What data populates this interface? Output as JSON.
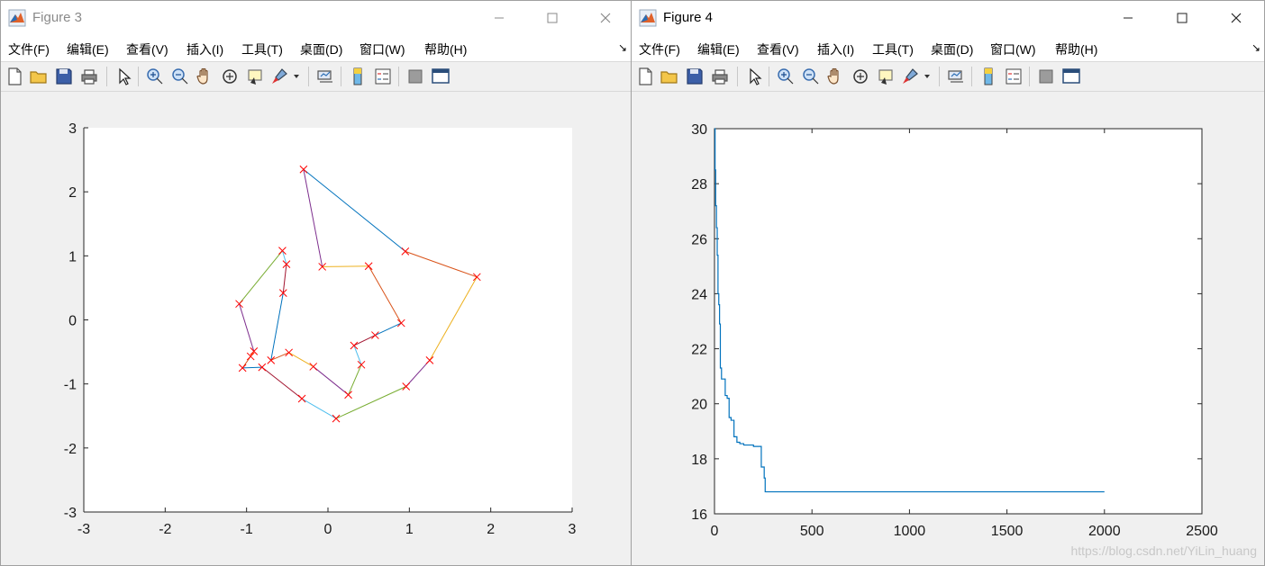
{
  "windows": [
    {
      "title": "Figure 3",
      "menus": [
        "文件(F)",
        "编辑(E)",
        "查看(V)",
        "插入(I)",
        "工具(T)",
        "桌面(D)",
        "窗口(W)",
        "帮助(H)"
      ]
    },
    {
      "title": "Figure 4",
      "menus": [
        "文件(F)",
        "编辑(E)",
        "查看(V)",
        "插入(I)",
        "工具(T)",
        "桌面(D)",
        "窗口(W)",
        "帮助(H)"
      ]
    }
  ],
  "toolbar_icons": [
    "new-figure-icon",
    "open-file-icon",
    "save-icon",
    "print-icon",
    "edit-plot-icon",
    "zoom-in-icon",
    "zoom-out-icon",
    "pan-icon",
    "rotate-3d-icon",
    "data-cursor-icon",
    "brush-icon",
    "brush-dropdown-icon",
    "link-plot-icon",
    "insert-colorbar-icon",
    "insert-legend-icon",
    "hide-plot-tools-icon",
    "show-plot-tools-icon"
  ],
  "watermark": "https://blog.csdn.net/YiLin_huang",
  "chart_data": [
    {
      "type": "line",
      "xlim": [
        -3,
        3
      ],
      "ylim": [
        -3,
        3
      ],
      "xticks": [
        "-3",
        "-2",
        "-1",
        "0",
        "1",
        "2",
        "3"
      ],
      "yticks": [
        "-3",
        "-2",
        "-1",
        "0",
        "1",
        "2",
        "3"
      ],
      "marker": "x",
      "marker_color": "#ff0000",
      "segment_colors": [
        "#0072bd",
        "#d95319",
        "#edb120",
        "#7e2f8e",
        "#77ac30",
        "#4dbeee",
        "#a2142f"
      ],
      "route": [
        [
          -0.3,
          2.35
        ],
        [
          0.95,
          1.07
        ],
        [
          1.83,
          0.67
        ],
        [
          1.25,
          -0.63
        ],
        [
          0.96,
          -1.04
        ],
        [
          0.1,
          -1.54
        ],
        [
          -0.32,
          -1.23
        ],
        [
          -0.81,
          -0.74
        ],
        [
          -1.05,
          -0.75
        ],
        [
          -0.95,
          -0.57
        ],
        [
          -0.91,
          -0.49
        ],
        [
          -1.09,
          0.25
        ],
        [
          -0.56,
          1.08
        ],
        [
          -0.51,
          0.87
        ],
        [
          -0.55,
          0.42
        ],
        [
          -0.7,
          -0.63
        ],
        [
          -0.48,
          -0.51
        ],
        [
          -0.18,
          -0.73
        ],
        [
          0.25,
          -1.17
        ],
        [
          0.41,
          -0.7
        ],
        [
          0.32,
          -0.4
        ],
        [
          0.58,
          -0.24
        ],
        [
          0.9,
          -0.05
        ],
        [
          0.5,
          0.84
        ],
        [
          -0.07,
          0.83
        ],
        [
          -0.3,
          2.35
        ]
      ]
    },
    {
      "type": "line",
      "xlim": [
        0,
        2500
      ],
      "ylim": [
        16,
        30
      ],
      "xticks": [
        "0",
        "500",
        "1000",
        "1500",
        "2000",
        "2500"
      ],
      "yticks": [
        "16",
        "18",
        "20",
        "22",
        "24",
        "26",
        "28",
        "30"
      ],
      "series_color": "#0072bd",
      "x": [
        0,
        3,
        6,
        10,
        14,
        18,
        22,
        26,
        30,
        36,
        45,
        55,
        65,
        75,
        85,
        100,
        115,
        130,
        150,
        170,
        200,
        230,
        240,
        250,
        255,
        260,
        2000
      ],
      "y": [
        30,
        28.5,
        27.2,
        26.4,
        25.4,
        24.0,
        23.6,
        22.9,
        21.3,
        20.9,
        20.9,
        20.3,
        20.2,
        19.5,
        19.4,
        18.8,
        18.6,
        18.55,
        18.5,
        18.5,
        18.45,
        18.45,
        17.7,
        17.7,
        17.3,
        16.8,
        16.8
      ]
    }
  ]
}
